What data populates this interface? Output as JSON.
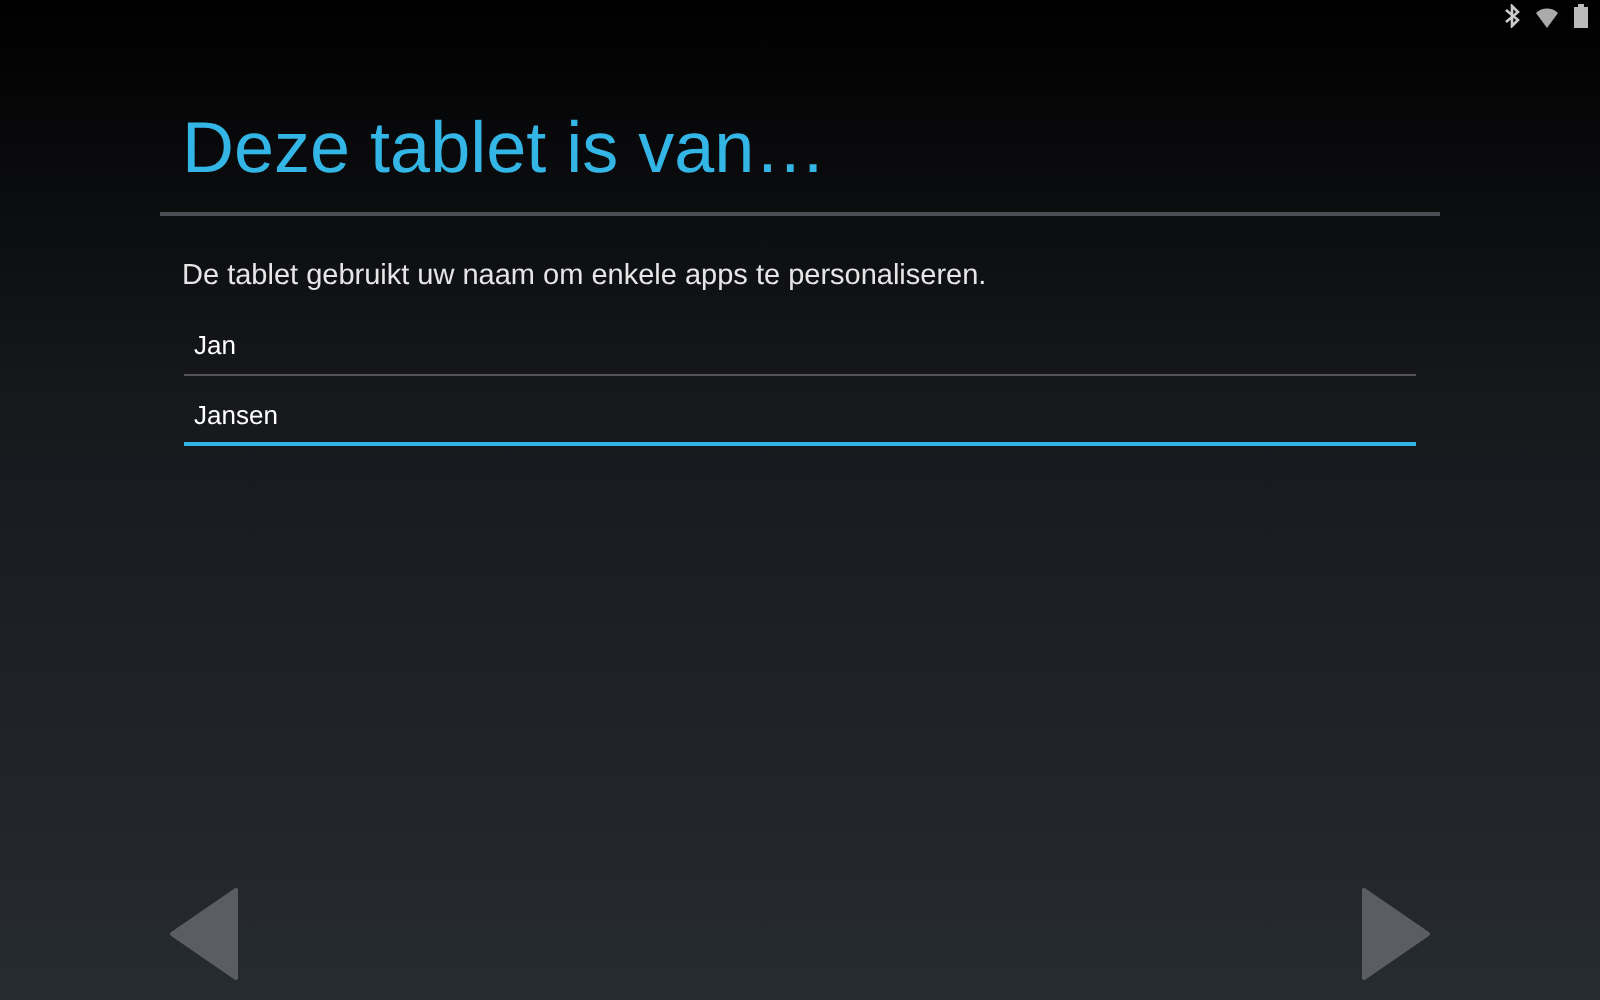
{
  "title": "Deze tablet is van…",
  "description": "De tablet gebruikt uw naam om enkele apps te personaliseren.",
  "fields": [
    {
      "value": "Jan",
      "focused": false
    },
    {
      "value": "Jansen",
      "focused": true
    }
  ]
}
